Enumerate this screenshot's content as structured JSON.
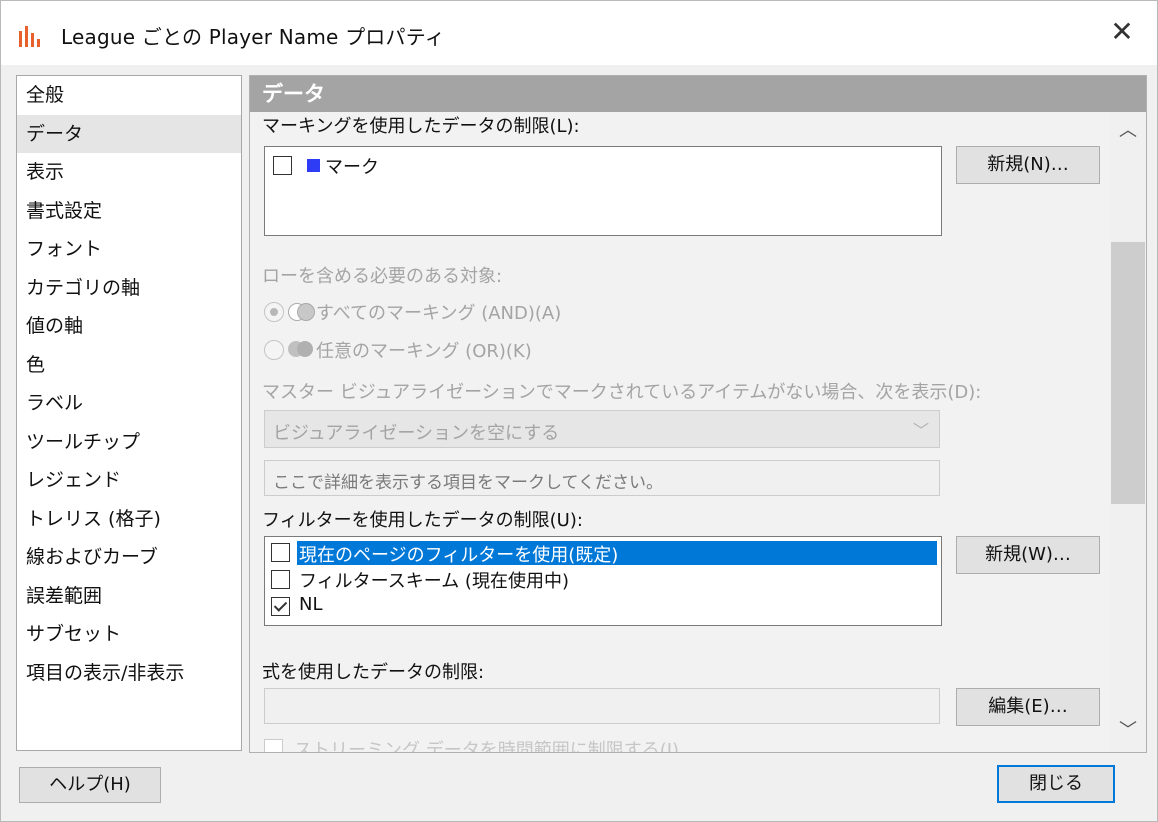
{
  "window": {
    "title": "League ごとの Player Name プロパティ",
    "close_symbol": "✕",
    "icon": "bar-chart-icon"
  },
  "nav": {
    "items": [
      "全般",
      "データ",
      "表示",
      "書式設定",
      "フォント",
      "カテゴリの軸",
      "値の軸",
      "色",
      "ラベル",
      "ツールチップ",
      "レジェンド",
      "トレリス (格子)",
      "線およびカーブ",
      "誤差範囲",
      "サブセット",
      "項目の表示/非表示"
    ],
    "selected": "データ"
  },
  "panel": {
    "header": "データ",
    "marking_section": {
      "label": "マーキングを使用したデータの制限(L):",
      "items": [
        {
          "label": "マーク",
          "checked": false,
          "color": "#2e3cf5"
        }
      ],
      "new_button": "新規(N)…"
    },
    "rows_section": {
      "label": "ローを含める必要のある対象:",
      "options": [
        {
          "label": "すべてのマーキング (AND)(A)",
          "selected": true,
          "icon": "and-venn-icon"
        },
        {
          "label": "任意のマーキング (OR)(K)",
          "selected": false,
          "icon": "or-venn-icon"
        }
      ]
    },
    "master_section": {
      "label": "マスター ビジュアライゼーションでマークされているアイテムがない場合、次を表示(D):",
      "combo_value": "ビジュアライゼーションを空にする",
      "message_value": "ここで詳細を表示する項目をマークしてください。"
    },
    "filter_section": {
      "label": "フィルターを使用したデータの制限(U):",
      "items": [
        {
          "label": "現在のページのフィルターを使用(既定)",
          "checked": false,
          "selected": true
        },
        {
          "label": "フィルタースキーム (現在使用中)",
          "checked": false,
          "selected": false
        },
        {
          "label": "NL",
          "checked": true,
          "selected": false
        }
      ],
      "new_button": "新規(W)…"
    },
    "expression_section": {
      "label": "式を使用したデータの制限:",
      "value": "",
      "edit_button": "編集(E)…"
    },
    "cutoff_label": "ストリーミング データを時間範囲に制限する(I)"
  },
  "footer": {
    "help_button": "ヘルプ(H)",
    "close_button": "閉じる"
  },
  "colors": {
    "header_bg": "#a4a4a4",
    "selection": "#0078d7",
    "mark_swatch": "#2e3cf5",
    "icon_orange": "#e8612c"
  }
}
